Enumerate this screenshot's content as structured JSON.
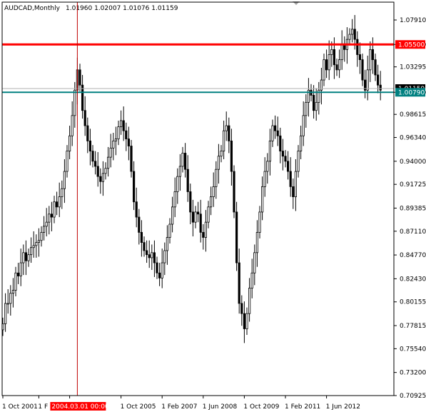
{
  "header": {
    "symbol": "AUDCAD,Monthly",
    "ohlc": "1.01960 1.02007 1.01076 1.01159"
  },
  "colors": {
    "candle": "#000000",
    "resistance": "#ff0000",
    "support": "#008080",
    "crosshair": "#c00000",
    "price_tag_bg": "#ff0000",
    "support_tag_bg": "#008080"
  },
  "chart_data": {
    "type": "candlestick",
    "title": "AUDCAD,Monthly",
    "ylim": [
      0.70925,
      1.089
    ],
    "y_ticks": [
      "1.07910",
      "1.05500",
      "1.03295",
      "1.00790",
      "0.98615",
      "0.96340",
      "0.94000",
      "0.91725",
      "0.89385",
      "0.87110",
      "0.84770",
      "0.82430",
      "0.80155",
      "0.77815",
      "0.75540",
      "0.73200",
      "0.70925"
    ],
    "y_tick_values": [
      1.0791,
      1.055,
      1.03295,
      1.0079,
      0.98615,
      0.9634,
      0.94,
      0.91725,
      0.89385,
      0.8711,
      0.8477,
      0.8243,
      0.80155,
      0.77815,
      0.7554,
      0.732,
      0.70925
    ],
    "x_ticks": [
      "1 Oct 2001",
      "1 F",
      "2004",
      "1 Oct 2005",
      "1 Feb 2007",
      "1 Jun 2008",
      "1 Oct 2009",
      "1 Feb 2011",
      "1 Jun 2012"
    ],
    "x_tick_index": [
      0,
      14,
      26,
      46,
      62,
      78,
      94,
      110,
      126
    ],
    "crosshair": {
      "date_label": "2004.03.01 00:00",
      "index": 29
    },
    "horizontal_lines": [
      {
        "price": 1.055,
        "label": "1.05500",
        "role": "resistance"
      },
      {
        "price": 1.0079,
        "label": "1.00790",
        "role": "support"
      }
    ],
    "current_price": "1.01159",
    "closes": [
      0.78,
      0.8,
      0.8,
      0.81,
      0.813,
      0.83,
      0.827,
      0.84,
      0.85,
      0.842,
      0.848,
      0.855,
      0.857,
      0.86,
      0.862,
      0.87,
      0.876,
      0.88,
      0.888,
      0.885,
      0.9,
      0.895,
      0.905,
      0.913,
      0.93,
      0.95,
      0.965,
      0.985,
      1.01,
      1.03,
      1.015,
      0.99,
      0.975,
      0.96,
      0.95,
      0.94,
      0.935,
      0.925,
      0.92,
      0.928,
      0.933,
      0.944,
      0.953,
      0.96,
      0.962,
      0.974,
      0.98,
      0.97,
      0.962,
      0.955,
      0.93,
      0.9,
      0.885,
      0.87,
      0.86,
      0.852,
      0.848,
      0.845,
      0.85,
      0.84,
      0.83,
      0.825,
      0.84,
      0.852,
      0.865,
      0.878,
      0.895,
      0.91,
      0.925,
      0.935,
      0.948,
      0.932,
      0.91,
      0.89,
      0.88,
      0.89,
      0.888,
      0.87,
      0.865,
      0.88,
      0.895,
      0.905,
      0.915,
      0.932,
      0.945,
      0.95,
      0.97,
      0.975,
      0.96,
      0.93,
      0.89,
      0.84,
      0.8,
      0.79,
      0.775,
      0.79,
      0.815,
      0.83,
      0.85,
      0.87,
      0.89,
      0.915,
      0.93,
      0.94,
      0.96,
      0.975,
      0.97,
      0.965,
      0.95,
      0.945,
      0.94,
      0.93,
      0.915,
      0.905,
      0.93,
      0.95,
      0.965,
      0.985,
      0.998,
      1.01,
      1.005,
      0.99,
      0.998,
      1.01,
      1.02,
      1.04,
      1.03,
      1.045,
      1.05,
      1.035,
      1.03,
      1.04,
      1.055,
      1.05,
      1.06,
      1.065,
      1.07,
      1.06,
      1.045,
      1.04,
      1.02,
      1.01,
      1.03,
      1.05,
      1.04,
      1.025,
      1.015,
      1.01
    ]
  }
}
